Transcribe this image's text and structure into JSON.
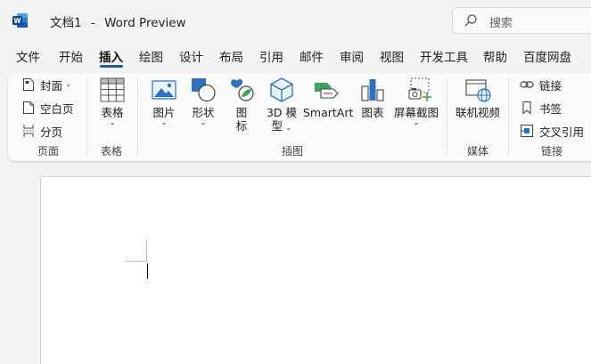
{
  "window": {
    "doc_name": "文档1",
    "separator": "-",
    "app_name": "Word Preview"
  },
  "search": {
    "placeholder": "搜索"
  },
  "tabs": [
    "文件",
    "开始",
    "插入",
    "绘图",
    "设计",
    "布局",
    "引用",
    "邮件",
    "审阅",
    "视图",
    "开发工具",
    "帮助",
    "百度网盘"
  ],
  "active_tab": "插入",
  "ribbon": {
    "pages": {
      "cover": "封面",
      "blank": "空白页",
      "break": "分页",
      "label": "页面"
    },
    "tables": {
      "table": "表格",
      "label": "表格"
    },
    "illustrations": {
      "pictures": "图片",
      "shapes": "形状",
      "icons_1": "图",
      "icons_2": "标",
      "models_1": "3D 模",
      "models_2": "型",
      "smartart": "SmartArt",
      "chart": "图表",
      "screenshot": "屏幕截图",
      "label": "插图"
    },
    "media": {
      "online_video": "联机视频",
      "label": "媒体"
    },
    "links": {
      "link": "链接",
      "bookmark": "书签",
      "cross_ref": "交叉引用",
      "label": "链接"
    }
  },
  "colors": {
    "accent": "#1f5aa8",
    "word_blue": "#185abd",
    "icon_blue": "#2b72c4",
    "icon_green": "#3aa655"
  },
  "caret_glyph": "⌄"
}
